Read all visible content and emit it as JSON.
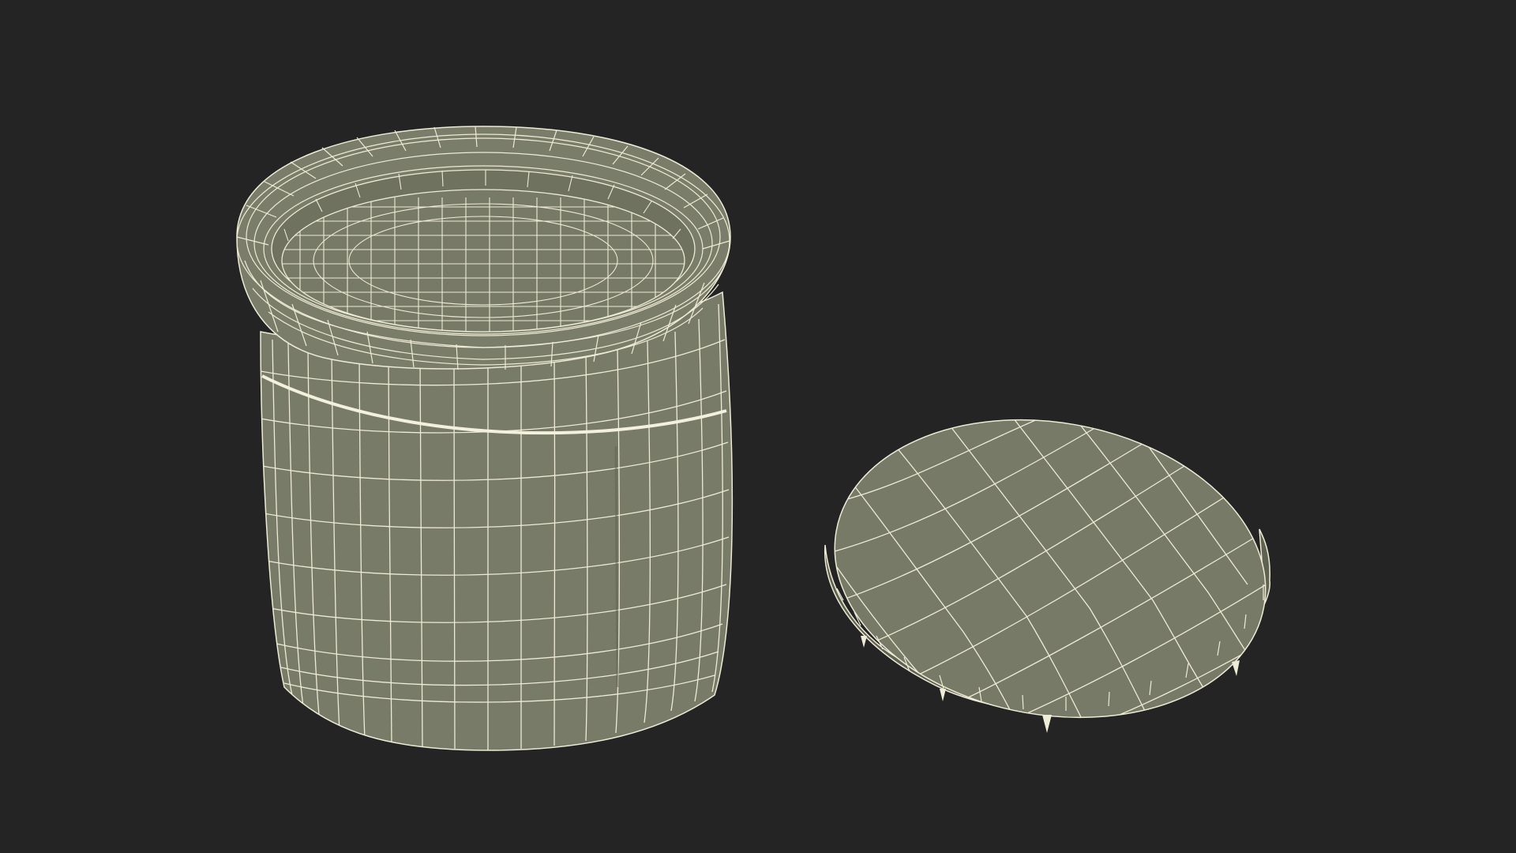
{
  "scene": {
    "background_color": "#242424",
    "surface_color": "#777a67",
    "surface_shade_color": "#6b6e5c",
    "surface_dark_color": "#5f6251",
    "wire_color": "#eeebd6",
    "objects": [
      {
        "name": "jar",
        "kind": "open container with rolled rim"
      },
      {
        "name": "lid",
        "kind": "flat round cap"
      }
    ]
  }
}
